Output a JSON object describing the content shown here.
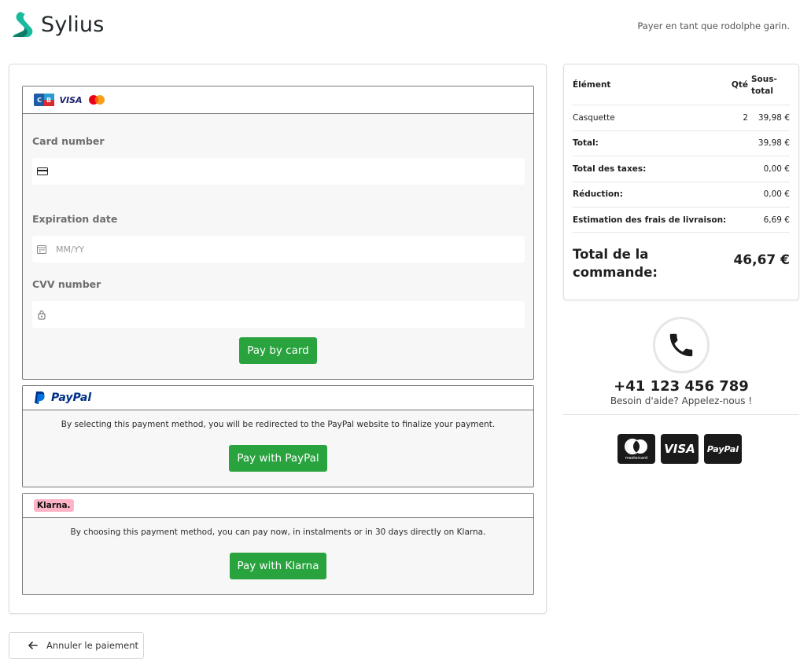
{
  "header": {
    "brand": "Sylius",
    "pay_as": "Payer en tant que rodolphe garin."
  },
  "card_method": {
    "icons": [
      "cb-card-icon",
      "visa-icon",
      "mastercard-icon"
    ],
    "card_number_label": "Card number",
    "card_number_placeholder": "",
    "expiration_label": "Expiration date",
    "expiration_placeholder": "MM/YY",
    "cvv_label": "CVV number",
    "cvv_placeholder": "",
    "pay_button": "Pay by card"
  },
  "paypal_method": {
    "logo_text": "PayPal",
    "description": "By selecting this payment method, you will be redirected to the PayPal website to finalize your payment.",
    "pay_button": "Pay with PayPal"
  },
  "klarna_method": {
    "logo_text": "Klarna.",
    "description": "By choosing this payment method, you can pay now, in instalments or in 30 days directly on Klarna.",
    "pay_button": "Pay with Klarna"
  },
  "summary": {
    "headers": {
      "item": "Élément",
      "qty": "Qté",
      "subtotal_line1": "Sous-",
      "subtotal_line2": "total"
    },
    "items": [
      {
        "name": "Casquette",
        "qty": "2",
        "subtotal": "39,98 €"
      }
    ],
    "total_label": "Total:",
    "total_value": "39,98 €",
    "taxes_label": "Total des taxes:",
    "taxes_value": "0,00 €",
    "discount_label": "Réduction:",
    "discount_value": "0,00 €",
    "shipping_label": "Estimation des frais de livraison:",
    "shipping_value": "6,69 €",
    "order_total_line1": "Total de la",
    "order_total_line2": "commande:",
    "order_total_value": "46,67 €"
  },
  "help": {
    "phone": "+41 123 456 789",
    "text": "Besoin d'aide? Appelez-nous !"
  },
  "payment_logos": {
    "mastercard_caption": "mastercard",
    "visa": "VISA",
    "paypal": "PayPal"
  },
  "cancel_button": "Annuler le paiement",
  "colors": {
    "primary_green": "#28a33e",
    "brand_teal": "#1abb9c",
    "paypal_dark": "#003087",
    "paypal_light": "#0070e0",
    "klarna_pink": "#ffb3c7"
  }
}
